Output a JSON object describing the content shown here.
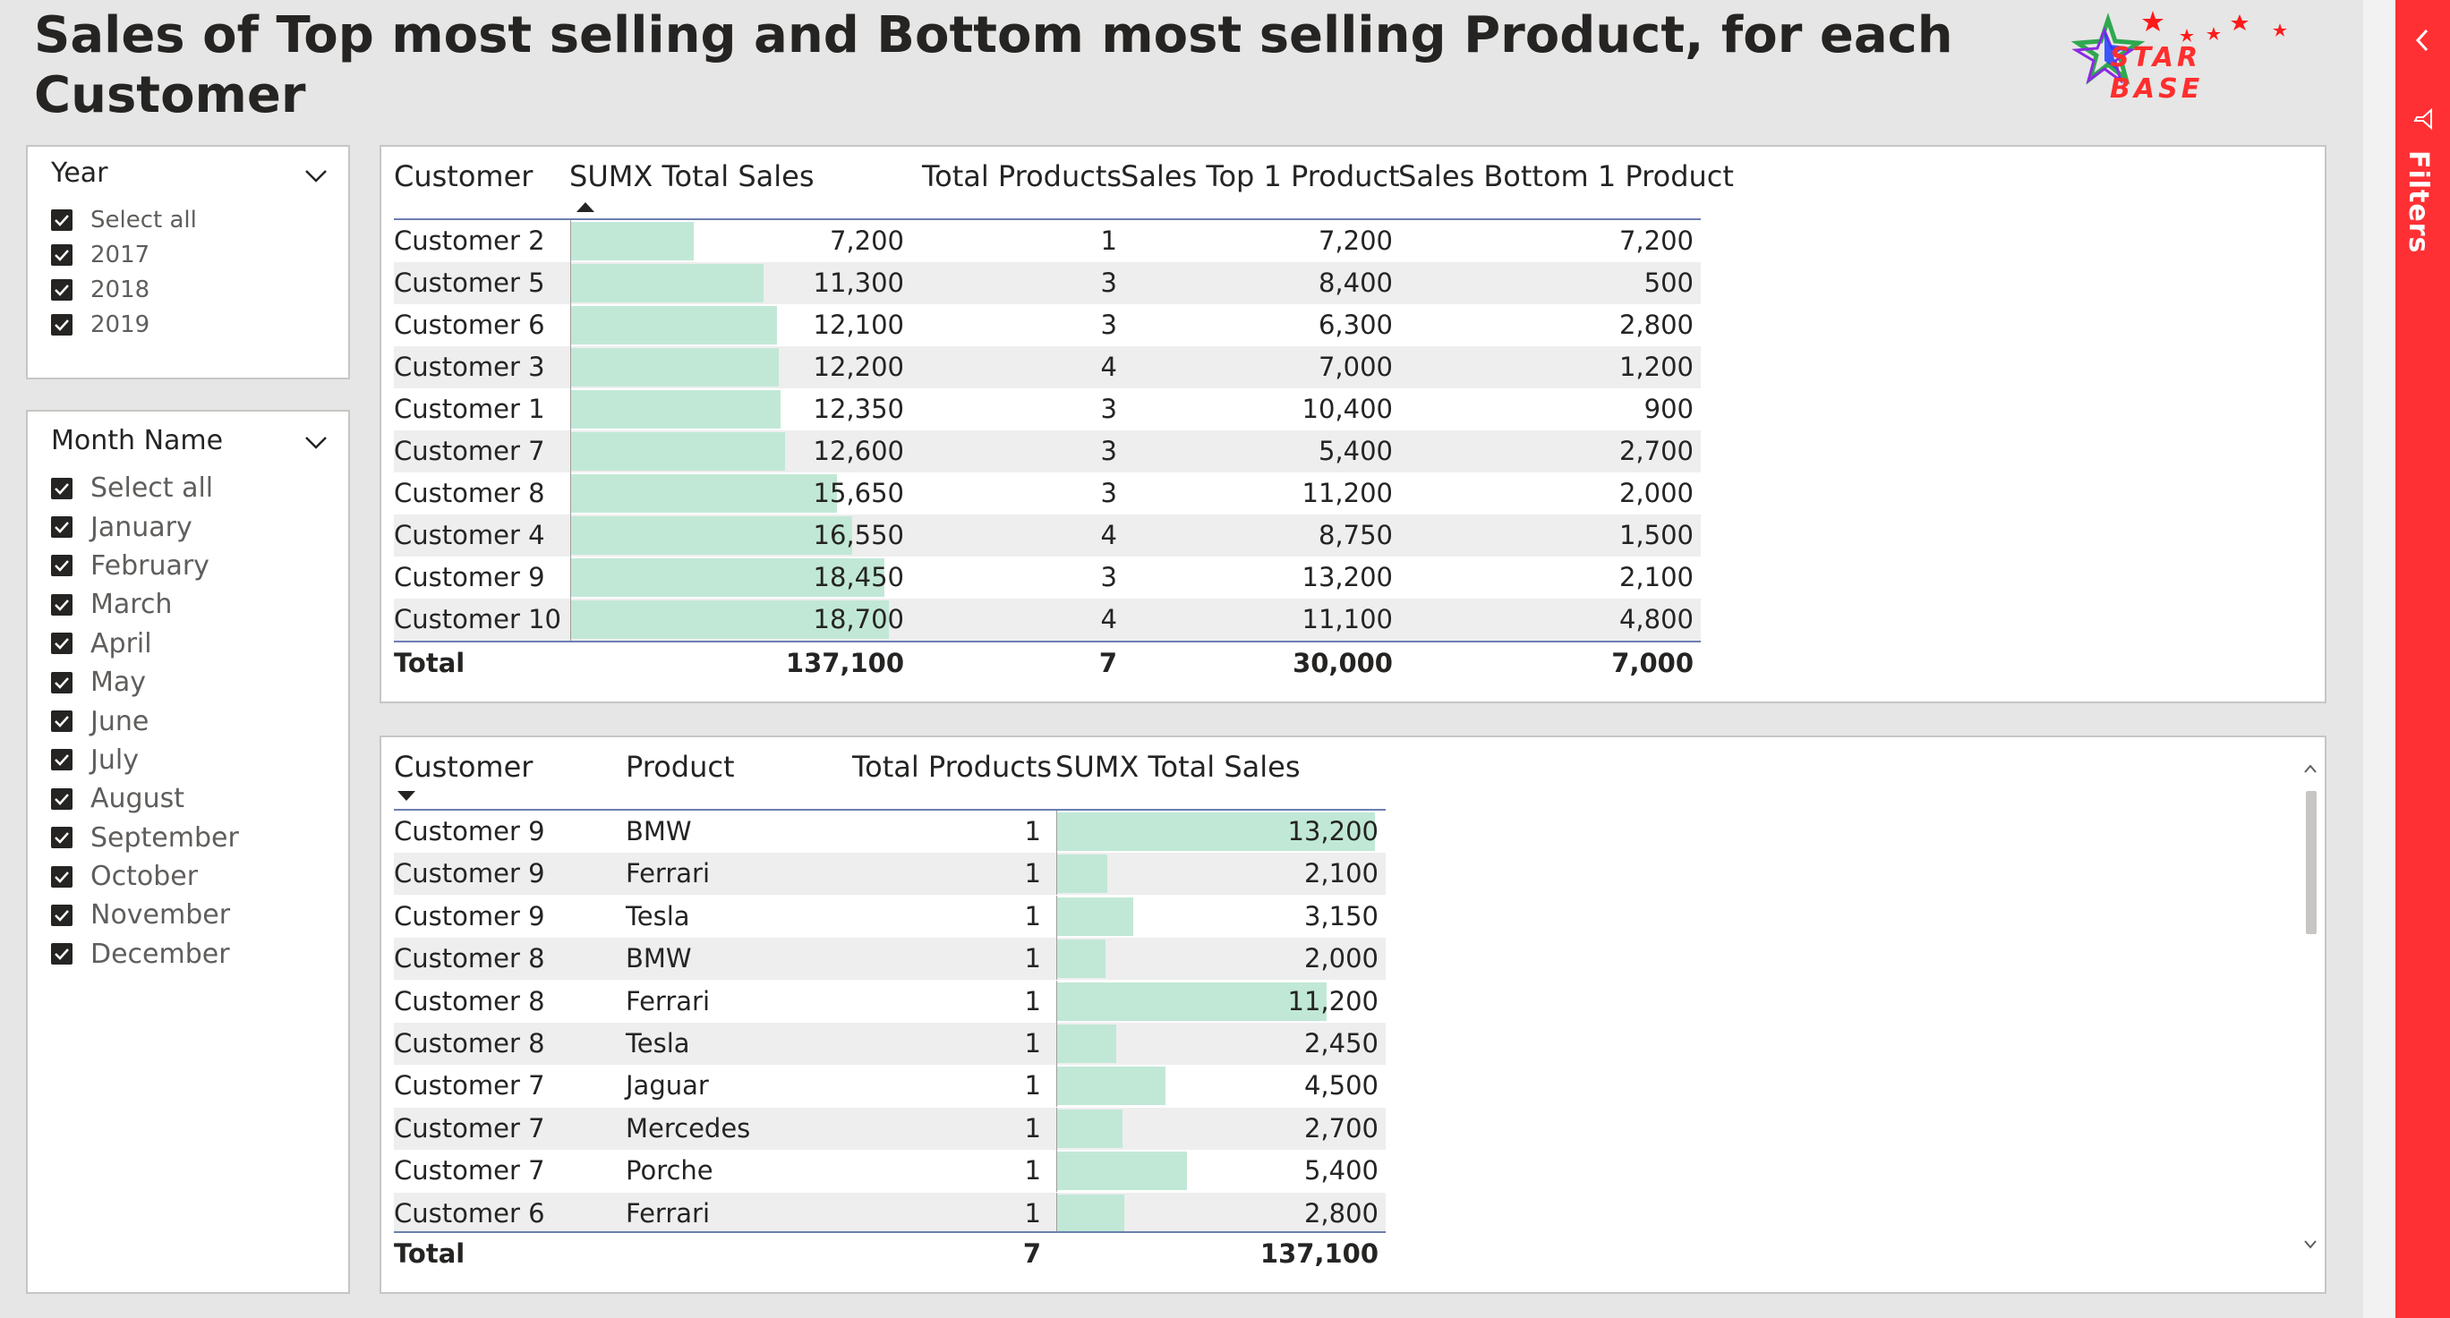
{
  "report": {
    "title": "Sales of Top most selling and Bottom most selling Product, for each Customer",
    "logo_text": "STAR BASE"
  },
  "slicers": {
    "year": {
      "title": "Year",
      "items": [
        "Select all",
        "2017",
        "2018",
        "2019"
      ],
      "checked": [
        true,
        true,
        true,
        true
      ]
    },
    "month": {
      "title": "Month Name",
      "items": [
        "Select all",
        "January",
        "February",
        "March",
        "April",
        "May",
        "June",
        "July",
        "August",
        "September",
        "October",
        "November",
        "December"
      ],
      "checked": [
        true,
        true,
        true,
        true,
        true,
        true,
        true,
        true,
        true,
        true,
        true,
        true,
        true
      ]
    }
  },
  "table1": {
    "columns": [
      "Customer",
      "SUMX Total Sales",
      "Total Products",
      "Sales Top 1 Product",
      "Sales Bottom 1 Product"
    ],
    "sort": "ascending",
    "rows": [
      {
        "customer": "Customer 2",
        "sumx": "7,200",
        "total_products": "1",
        "top1": "7,200",
        "bottom1": "7,200",
        "bar_value": 7200
      },
      {
        "customer": "Customer 5",
        "sumx": "11,300",
        "total_products": "3",
        "top1": "8,400",
        "bottom1": "500",
        "bar_value": 11300
      },
      {
        "customer": "Customer 6",
        "sumx": "12,100",
        "total_products": "3",
        "top1": "6,300",
        "bottom1": "2,800",
        "bar_value": 12100
      },
      {
        "customer": "Customer 3",
        "sumx": "12,200",
        "total_products": "4",
        "top1": "7,000",
        "bottom1": "1,200",
        "bar_value": 12200
      },
      {
        "customer": "Customer 1",
        "sumx": "12,350",
        "total_products": "3",
        "top1": "10,400",
        "bottom1": "900",
        "bar_value": 12350
      },
      {
        "customer": "Customer 7",
        "sumx": "12,600",
        "total_products": "3",
        "top1": "5,400",
        "bottom1": "2,700",
        "bar_value": 12600
      },
      {
        "customer": "Customer 8",
        "sumx": "15,650",
        "total_products": "3",
        "top1": "11,200",
        "bottom1": "2,000",
        "bar_value": 15650
      },
      {
        "customer": "Customer 4",
        "sumx": "16,550",
        "total_products": "4",
        "top1": "8,750",
        "bottom1": "1,500",
        "bar_value": 16550
      },
      {
        "customer": "Customer 9",
        "sumx": "18,450",
        "total_products": "3",
        "top1": "13,200",
        "bottom1": "2,100",
        "bar_value": 18450
      },
      {
        "customer": "Customer 10",
        "sumx": "18,700",
        "total_products": "4",
        "top1": "11,100",
        "bottom1": "4,800",
        "bar_value": 18700
      }
    ],
    "bar_max": 18700,
    "total": {
      "label": "Total",
      "sumx": "137,100",
      "total_products": "7",
      "top1": "30,000",
      "bottom1": "7,000"
    }
  },
  "table2": {
    "columns": [
      "Customer",
      "Product",
      "Total Products",
      "SUMX Total Sales"
    ],
    "sort": "descending",
    "rows": [
      {
        "customer": "Customer 9",
        "product": "BMW",
        "total_products": "1",
        "sumx": "13,200",
        "bar_value": 13200
      },
      {
        "customer": "Customer 9",
        "product": "Ferrari",
        "total_products": "1",
        "sumx": "2,100",
        "bar_value": 2100
      },
      {
        "customer": "Customer 9",
        "product": "Tesla",
        "total_products": "1",
        "sumx": "3,150",
        "bar_value": 3150
      },
      {
        "customer": "Customer 8",
        "product": "BMW",
        "total_products": "1",
        "sumx": "2,000",
        "bar_value": 2000
      },
      {
        "customer": "Customer 8",
        "product": "Ferrari",
        "total_products": "1",
        "sumx": "11,200",
        "bar_value": 11200
      },
      {
        "customer": "Customer 8",
        "product": "Tesla",
        "total_products": "1",
        "sumx": "2,450",
        "bar_value": 2450
      },
      {
        "customer": "Customer 7",
        "product": "Jaguar",
        "total_products": "1",
        "sumx": "4,500",
        "bar_value": 4500
      },
      {
        "customer": "Customer 7",
        "product": "Mercedes",
        "total_products": "1",
        "sumx": "2,700",
        "bar_value": 2700
      },
      {
        "customer": "Customer 7",
        "product": "Porche",
        "total_products": "1",
        "sumx": "5,400",
        "bar_value": 5400
      },
      {
        "customer": "Customer 6",
        "product": "Ferrari",
        "total_products": "1",
        "sumx": "2,800",
        "bar_value": 2800
      }
    ],
    "bar_max": 13200,
    "total": {
      "label": "Total",
      "total_products": "7",
      "sumx": "137,100"
    }
  },
  "filters_pane": {
    "label": "Filters"
  },
  "colors": {
    "accent": "#ff3034",
    "data_bar": "#c1e8d6",
    "row_alt": "#eeeeee",
    "divider": "#6b7fb0"
  }
}
